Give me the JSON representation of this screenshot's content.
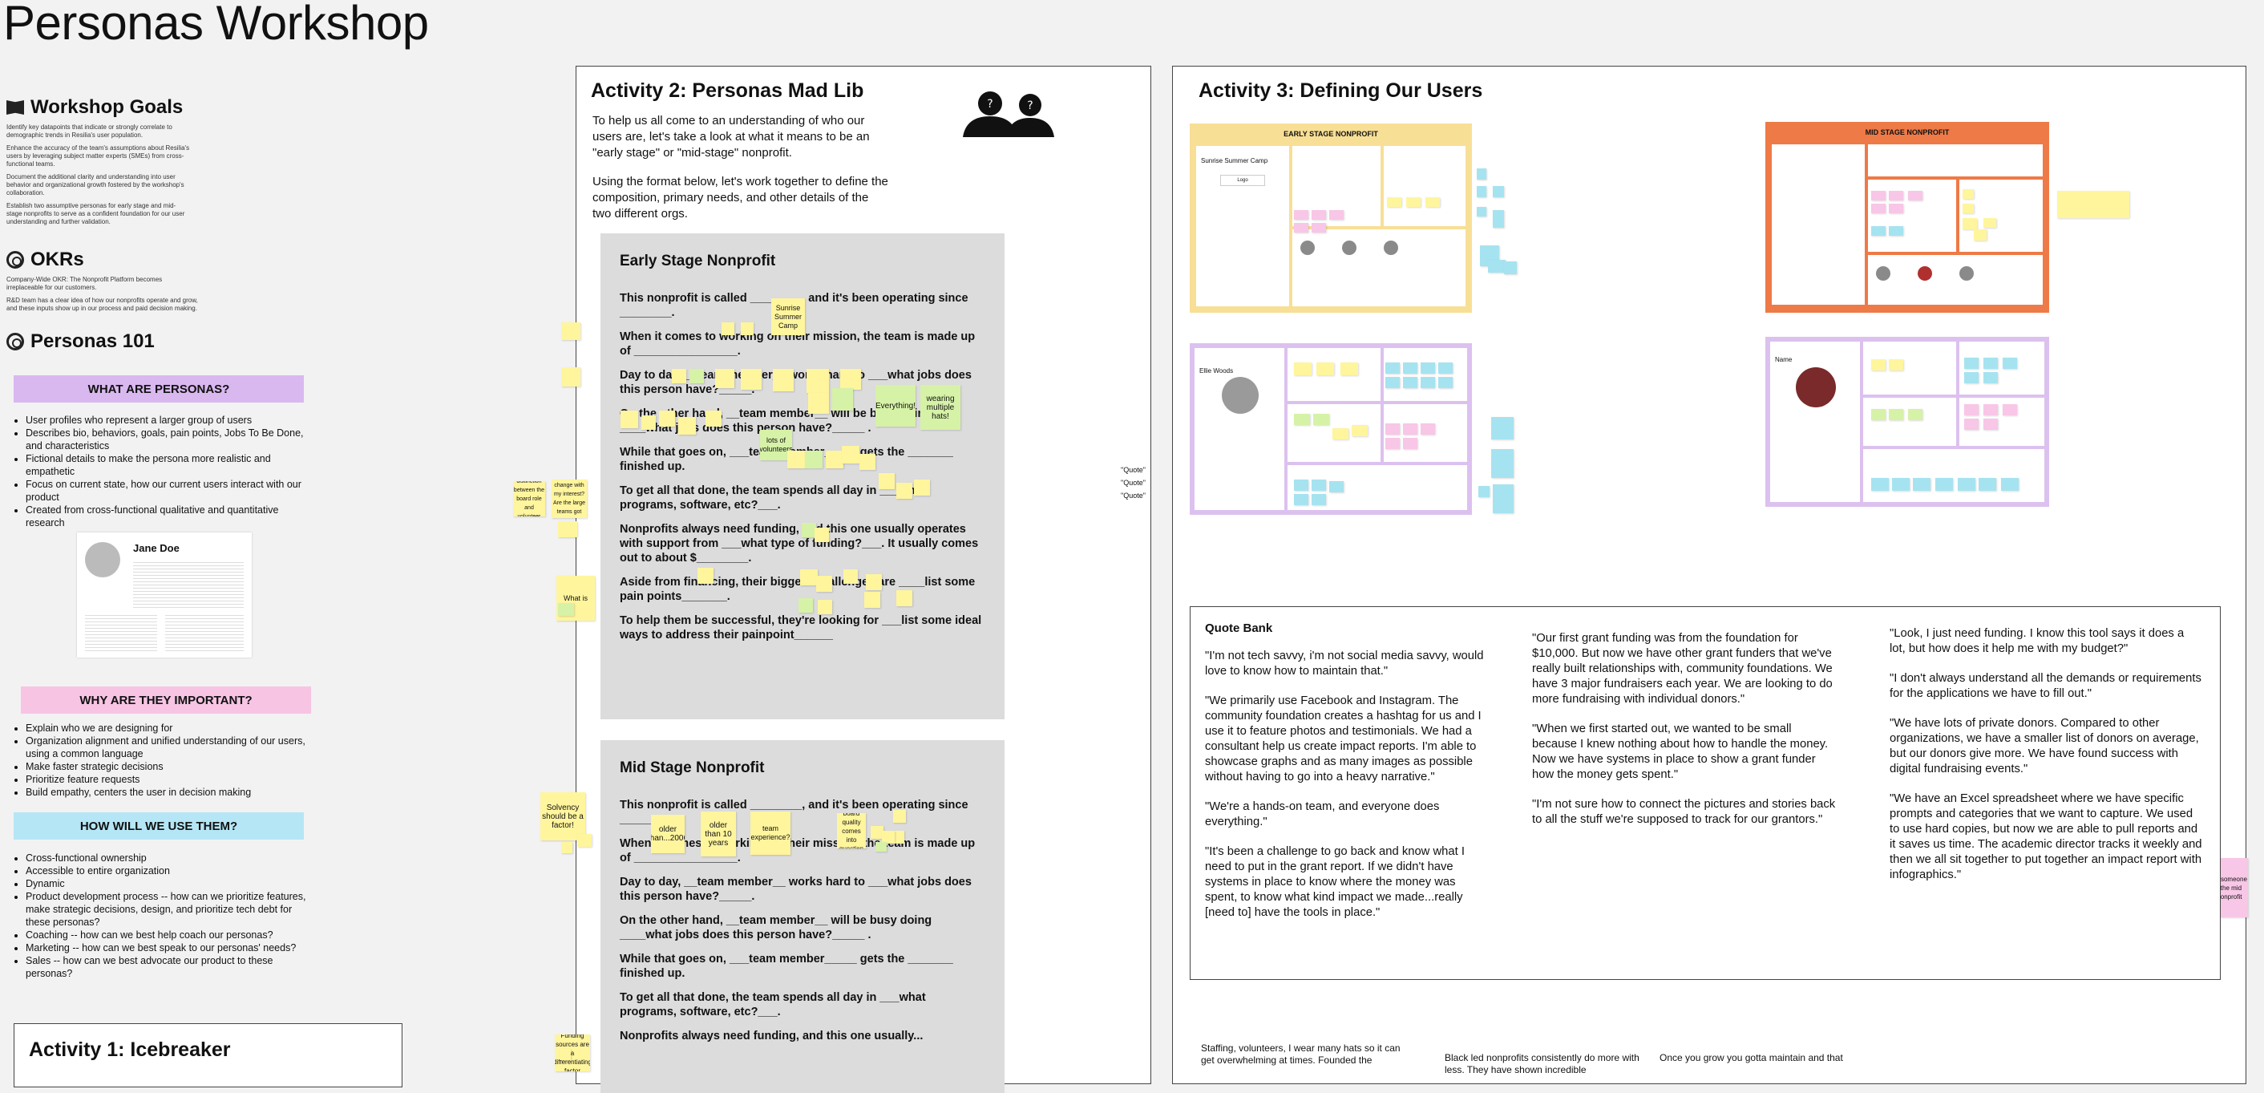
{
  "page_title": "Personas Workshop",
  "left": {
    "goals_title": "Workshop Goals",
    "goals": [
      "Identify key datapoints that indicate or strongly correlate to demographic trends in Resilia's user population.",
      "Enhance the accuracy of the team's assumptions about Resilia's users by leveraging subject matter experts (SMEs) from cross-functional teams.",
      "Document the additional clarity and understanding into user behavior and organizational growth fostered by the workshop's collaboration.",
      "Establish two assumptive personas for early stage and mid-stage nonprofits to serve as a confident foundation for our user understanding and further validation."
    ],
    "okrs_title": "OKRs",
    "okrs": [
      "Company-Wide OKR: The Nonprofit Platform becomes irreplaceable for our customers.",
      "R&D team has a clear idea of how our nonprofits operate and grow, and these inputs show up in our process and paid decision making."
    ],
    "p101_title": "Personas 101",
    "what_title": "WHAT ARE PERSONAS?",
    "what_items": [
      "User profiles who represent a larger group of users",
      "Describes bio, behaviors, goals, pain points, Jobs To Be Done, and characteristics",
      "Fictional details to make the persona more realistic and empathetic",
      "Focus on current state, how our current users interact with our product",
      "Created from cross-functional qualitative and quantitative research"
    ],
    "example_name": "Jane Doe",
    "why_title": "WHY ARE THEY IMPORTANT?",
    "why_items": [
      "Explain who we are designing for",
      "Organization alignment and unified understanding of our users, using a common language",
      "Make faster strategic decisions",
      "Prioritize feature requests",
      "Build empathy, centers the user in decision making"
    ],
    "how_title": "HOW WILL WE USE THEM?",
    "how_items": [
      "Cross-functional ownership",
      "Accessible to entire organization",
      "Dynamic",
      "Product development process -- how can we prioritize features, make strategic decisions, design, and prioritize tech debt for these personas?",
      "Coaching -- how can we best help coach our personas?",
      "Marketing -- how can we best speak to our personas' needs?",
      "Sales -- how can we best advocate our product to these personas?"
    ],
    "activity1_title": "Activity 1: Icebreaker"
  },
  "activity2": {
    "title": "Activity 2: Personas Mad Lib",
    "intro1": "To help us all come to an understanding of who our users are, let's take a look at what it means to be an \"early stage\" or \"mid-stage\" nonprofit.",
    "intro2": "Using the format below, let's work together to define the composition, primary needs, and other details of the two different orgs.",
    "early_title": "Early Stage Nonprofit",
    "mid_title": "Mid Stage Nonprofit",
    "early_lines": [
      "This nonprofit is called ________, and it's been operating since ________.",
      "When it comes to working on their mission, the team is made up of ________________.",
      "Day to day, __team member__ works hard to ___what jobs does this person have?_____.",
      "On the other hand, __team member__ will be busy doing ____what jobs does this person have?_____ .",
      "While that goes on, ___team member_____ gets the _______ finished up.",
      "To get all that done, the team spends all day in ___what programs, software, etc?___.",
      "Nonprofits always need funding, and this one usually operates with support from ___what type of funding?___. It usually comes out to about $________.",
      "Aside from financing, their biggest challenges are ____list some pain points_______.",
      "To help them be successful, they're looking for ___list some ideal ways to address their painpoint______"
    ],
    "mid_lines": [
      "This nonprofit is called ________, and it's been operating since ________.",
      "When it comes to working on their mission, the team is made up of ________________.",
      "Day to day, __team member__ works hard to ___what jobs does this person have?_____.",
      "On the other hand, __team member__ will be busy doing ____what jobs does this person have?_____ .",
      "While that goes on, ___team member_____ gets the _______ finished up.",
      "To get all that done, the team spends all day in ___what programs, software, etc?___.",
      "Nonprofits always need funding, and this one usually..."
    ],
    "stickies": {
      "sunrise": "Sunrise Summer Camp",
      "everything": "Everything!",
      "wearing": "wearing multiple hats!",
      "lots": "lots of volunteers",
      "what_is": "What is",
      "solvency": "Solvency should be a factor!",
      "older2006": "older than...2006",
      "older10": "older than 10 years",
      "team_exp": "team experience?",
      "board": "board quality comes into question",
      "funding": "Funding sources are a differentiating factor",
      "quote": "\"Quote\""
    },
    "side_notes": [
      "is there a distinction between the board role and volunteer role?",
      "How data moved change with my interest? Are the large teams got more specialized?"
    ]
  },
  "activity3": {
    "title": "Activity 3: Defining Our Users",
    "early_board": "EARLY STAGE NONPROFIT",
    "mid_board": "MID STAGE NONPROFIT",
    "early_org": "Sunrise Summer Camp",
    "early_person": "Ellie Woods",
    "mid_person": "Name",
    "pink_note": "might be someone else at the mid stage nonprofit",
    "quote_bank_title": "Quote Bank",
    "quotes_col1": [
      "\"I'm not tech savvy, i'm not social media savvy, would love to know how to maintain that.\"",
      "\"We primarily use Facebook and Instagram. The community foundation creates a hashtag for us and I use it to feature photos and testimonials. We had a consultant help us create impact reports. I'm able to showcase graphs and as many images as possible without having to go into a heavy narrative.\"",
      "\"We're a hands-on team, and everyone does everything.\"",
      "\"It's been a challenge to go back and know what I need to put in the grant report. If we didn't have systems in place to know where the money was spent, to know what kind impact we made...really [need to] have the tools in place.\""
    ],
    "quotes_col2": [
      "\"Our first grant funding was from the foundation for $10,000. But now we have other grant funders that we've really built relationships with, community foundations. We have 3 major fundraisers each year. We are looking to do more fundraising with individual donors.\"",
      "\"When we first started out, we wanted to be small because I knew nothing about how to handle the money. Now we have systems in place to show a grant funder how the money gets spent.\"",
      "\"I'm not sure how to connect the pictures and stories back to all the stuff we're supposed to track for our grantors.\""
    ],
    "quotes_col3": [
      "\"Look, I just need funding. I know this tool says it does a lot, but how does it help me with my budget?\"",
      "\"I don't always understand all the demands or requirements for the applications we have to fill out.\"",
      "\"We have lots of private donors. Compared to other organizations, we have a smaller list of donors on average, but our donors give more. We have found success with digital fundraising events.\"",
      "\"We have an Excel spreadsheet where we have specific prompts and categories that we want to capture. We used to use hard copies, but now we are able to pull reports and it saves us time. The academic director tracks it weekly and then we all sit together to put together an impact report with infographics.\""
    ],
    "bottom_snippets": [
      "Staffing, volunteers, I wear many hats so it can get overwhelming at times. Founded the",
      "Black led nonprofits consistently do more with less. They have shown incredible",
      "Once you grow you gotta maintain and that"
    ]
  },
  "colors": {
    "background": "#f2f2f2",
    "purple_band": "#d9b8f0",
    "pink_band": "#f7c4e4",
    "blue_band": "#b5e6f5",
    "sticky_yellow": "#fff59d",
    "early_board": "#f8df96",
    "mid_board": "#ee7a47",
    "persona_board": "#dcc1ef"
  }
}
